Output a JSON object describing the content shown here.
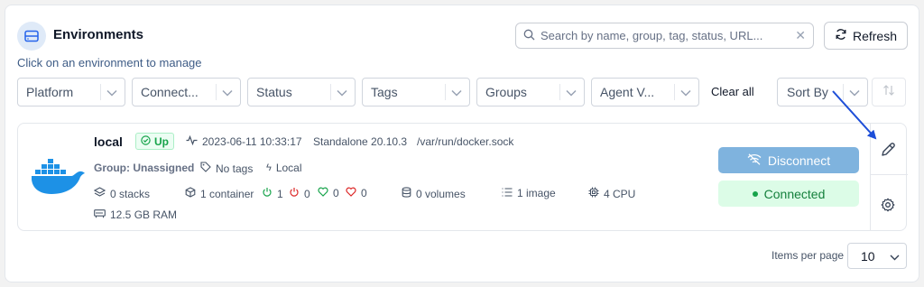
{
  "header": {
    "title": "Environments",
    "subtitle": "Click on an environment to manage",
    "search_placeholder": "Search by name, group, tag, status, URL...",
    "refresh_label": "Refresh"
  },
  "filters": [
    {
      "label": "Platform"
    },
    {
      "label": "Connect..."
    },
    {
      "label": "Status"
    },
    {
      "label": "Tags"
    },
    {
      "label": "Groups"
    },
    {
      "label": "Agent V..."
    }
  ],
  "clear_all_label": "Clear all",
  "sort_by_label": "Sort By",
  "environment": {
    "name": "local",
    "status": "Up",
    "timestamp": "2023-06-11 10:33:17",
    "type": "Standalone 20.10.3",
    "url": "/var/run/docker.sock",
    "group": "Group: Unassigned",
    "tags": "No tags",
    "location": "Local",
    "stacks": "0 stacks",
    "containers": "1 container",
    "running": "1",
    "stopped": "0",
    "healthy": "0",
    "unhealthy": "0",
    "volumes": "0 volumes",
    "images": "1 image",
    "cpu": "4 CPU",
    "ram": "12.5 GB RAM",
    "disconnect_label": "Disconnect",
    "connected_label": "Connected"
  },
  "pagination": {
    "items_per_page_label": "Items per page",
    "items_per_page_value": "10"
  },
  "colors": {
    "accent": "#1d4ed8",
    "up_green": "#16a34a",
    "stopped_red": "#dc2626",
    "docker_blue": "#1d91e6",
    "disconnect_bg": "#7fb3de",
    "connected_bg": "#dcfce7"
  }
}
